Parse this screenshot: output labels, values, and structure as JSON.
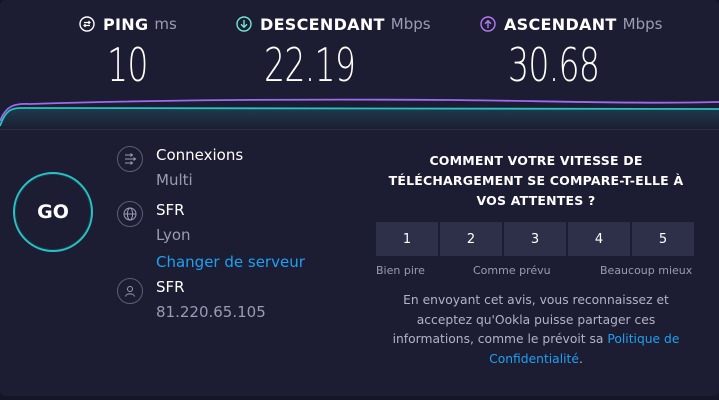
{
  "metrics": {
    "ping": {
      "name": "PING",
      "unit": "ms",
      "value": "10",
      "icon": "ping-icon",
      "color": "#ffffff"
    },
    "download": {
      "name": "DESCENDANT",
      "unit": "Mbps",
      "value": "22.19",
      "icon": "download-arrow-icon",
      "color": "#6ee7d8"
    },
    "upload": {
      "name": "ASCENDANT",
      "unit": "Mbps",
      "value": "30.68",
      "icon": "upload-arrow-icon",
      "color": "#b47cf5"
    }
  },
  "graph": {
    "download_color": "#27c2c2",
    "upload_color": "#9b6cf0"
  },
  "go_button": {
    "label": "GO",
    "color": "#27c2c2"
  },
  "connections": {
    "title": "Connexions",
    "value": "Multi",
    "icon": "connections-icon"
  },
  "server": {
    "title": "SFR",
    "location": "Lyon",
    "change_link": "Changer de serveur",
    "icon": "globe-icon"
  },
  "provider": {
    "title": "SFR",
    "ip": "81.220.65.105",
    "icon": "user-icon"
  },
  "survey": {
    "question": "COMMENT VOTRE VITESSE DE TÉLÉCHARGEMENT SE COMPARE-T-ELLE À VOS ATTENTES ?",
    "ratings": [
      "1",
      "2",
      "3",
      "4",
      "5"
    ],
    "label_low": "Bien pire",
    "label_mid": "Comme prévu",
    "label_high": "Beaucoup mieux",
    "disclaimer": "En envoyant cet avis, vous reconnaissez et acceptez qu'Ookla puisse partager ces informations, comme le prévoit sa",
    "privacy_link": "Politique de Confidentialité",
    "period": "."
  },
  "colors": {
    "background": "#1c1d32",
    "link": "#1ea1f2",
    "button": "#2e3049"
  }
}
